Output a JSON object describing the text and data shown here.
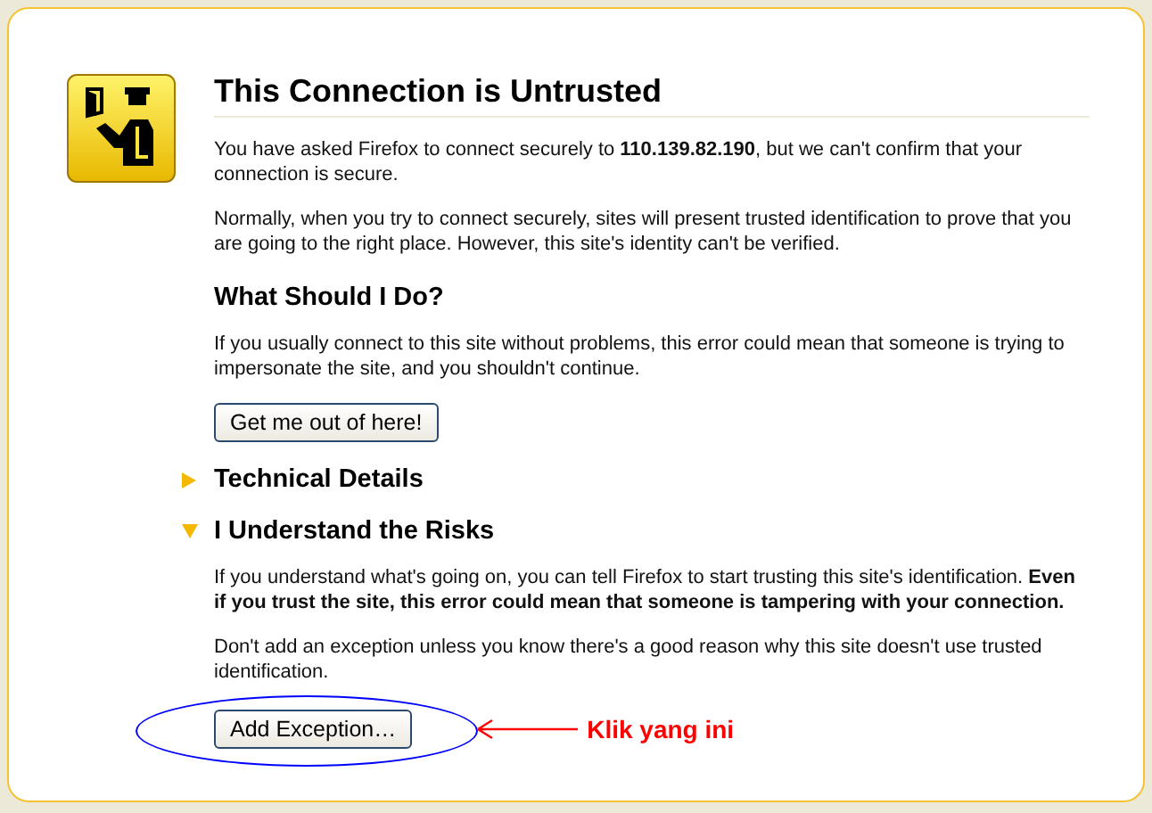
{
  "title": "This Connection is Untrusted",
  "intro": [
    "You have asked Firefox to connect securely to **110.139.82.190**, but we can't confirm that your connection is secure.",
    "Normally, when you try to connect securely, sites will present trusted identification to prove that you are going to the right place. However, this site's identity can't be verified."
  ],
  "what_to_do": {
    "heading": "What Should I Do?",
    "text": "If you usually connect to this site without problems, this error could mean that someone is trying to impersonate the site, and you shouldn't continue.",
    "button": "Get me out of here!"
  },
  "expanders": [
    {
      "label": "Technical Details",
      "expanded": false
    },
    {
      "label": "I Understand the Risks",
      "expanded": true,
      "paragraphs": [
        "If you understand what's going on, you can tell Firefox to start trusting this site's identification. **Even if you trust the site, this error could mean that someone is tampering with your connection.**",
        "Don't add an exception unless you know there's a good reason why this site doesn't use trusted identification."
      ],
      "button": "Add Exception…"
    }
  ],
  "annotation": {
    "label": "Klik yang ini"
  }
}
